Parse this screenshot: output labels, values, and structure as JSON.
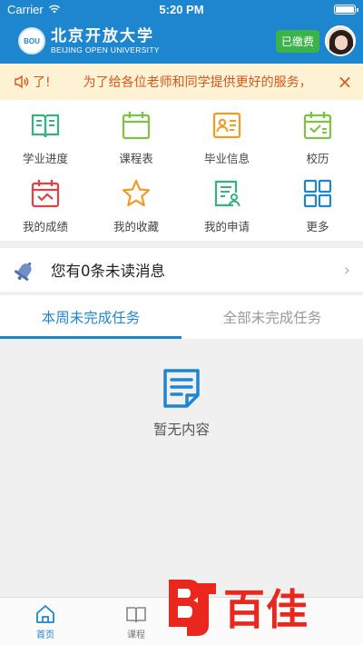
{
  "status_bar": {
    "carrier": "Carrier",
    "time": "5:20 PM",
    "battery_level": 1.0
  },
  "header": {
    "logo_mark": "BOU",
    "logo_cn": "北京开放大学",
    "logo_en": "BEIJING OPEN UNIVERSITY",
    "paid_badge": "已缴费"
  },
  "notice": {
    "icon": "speaker-icon",
    "prefix": "了!",
    "text": "为了给各位老师和同学提供更好的服务，",
    "close": "×"
  },
  "grid": [
    {
      "label": "学业进度",
      "icon": "open-book-icon",
      "color": "#35b37e"
    },
    {
      "label": "课程表",
      "icon": "calendar-icon",
      "color": "#7dc242"
    },
    {
      "label": "毕业信息",
      "icon": "id-card-icon",
      "color": "#f19b24"
    },
    {
      "label": "校历",
      "icon": "calendar-check-icon",
      "color": "#7dc242"
    },
    {
      "label": "我的成绩",
      "icon": "calendar-chart-icon",
      "color": "#e0424a"
    },
    {
      "label": "我的收藏",
      "icon": "star-icon",
      "color": "#f19b24"
    },
    {
      "label": "我的申请",
      "icon": "form-user-icon",
      "color": "#35b37e"
    },
    {
      "label": "更多",
      "icon": "grid-icon",
      "color": "#1e86cf"
    }
  ],
  "messages": {
    "text": "您有0条未读消息",
    "icon": "bell-icon",
    "arrow": "›"
  },
  "tabs": [
    {
      "label": "本周未完成任务",
      "active": true
    },
    {
      "label": "全部未完成任务",
      "active": false
    }
  ],
  "empty": {
    "text": "暂无内容",
    "icon": "document-icon"
  },
  "tabbar": [
    {
      "label": "首页",
      "icon": "home-icon",
      "active": true
    },
    {
      "label": "课程",
      "icon": "book-icon",
      "active": false
    },
    {
      "label": "",
      "icon": "",
      "active": false
    },
    {
      "label": "",
      "icon": "",
      "active": false
    }
  ],
  "watermark": {
    "text": "百佳",
    "mark": "BJ"
  }
}
